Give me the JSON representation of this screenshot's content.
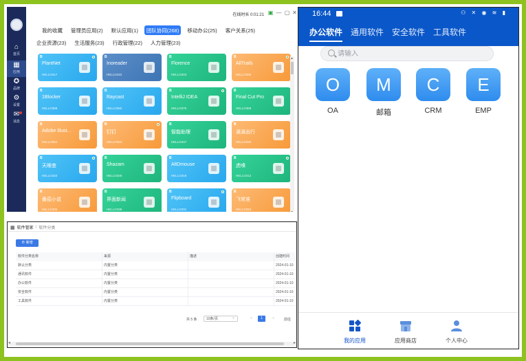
{
  "desktop": {
    "nav": [
      {
        "label": "首页",
        "icon": "home-icon"
      },
      {
        "label": "应用",
        "icon": "apps-icon"
      },
      {
        "label": "品牌",
        "icon": "brand-icon"
      },
      {
        "label": "设置",
        "icon": "settings-icon"
      },
      {
        "label": "消息",
        "icon": "message-icon"
      }
    ],
    "timer": "在线时长 0:01:21",
    "tabs_row1": [
      "我的收藏",
      "管理员应用(2)",
      "默认应用(1)",
      "团队协同(268)",
      "移动办公(25)",
      "客户关系(25)"
    ],
    "tabs_row2": [
      "企业资源(23)",
      "生活服务(23)",
      "行政管理(22)",
      "人力管理(23)"
    ],
    "cards": [
      {
        "name": "PlantNet",
        "sub": "HELLO417",
        "color": "blue",
        "badge": "B"
      },
      {
        "name": "Inoreader",
        "sub": "HELLO410",
        "color": "steel",
        "badge": "B"
      },
      {
        "name": "Florence",
        "sub": "HELLO403",
        "color": "green",
        "badge": "B"
      },
      {
        "name": "AllTrails",
        "sub": "HELLO396",
        "color": "orange",
        "badge": "B"
      },
      {
        "name": "1Blocker",
        "sub": "HELLO389",
        "color": "blue",
        "badge": "B"
      },
      {
        "name": "Raycast",
        "sub": "HELLO382",
        "color": "blue",
        "badge": "B"
      },
      {
        "name": "IntelliJ IDEA",
        "sub": "HELLO375",
        "color": "green",
        "badge": "B"
      },
      {
        "name": "Final Cut Pro",
        "sub": "HELLO368",
        "color": "green",
        "badge": "B"
      },
      {
        "name": "Adobe Illust...",
        "sub": "HELLO361",
        "color": "orange",
        "badge": "B"
      },
      {
        "name": "钉钉",
        "sub": "HELLO354",
        "color": "orange",
        "badge": "B"
      },
      {
        "name": "智能助理",
        "sub": "HELLO347",
        "color": "green",
        "badge": "B"
      },
      {
        "name": "滴滴出行",
        "sub": "HELLO340",
        "color": "orange",
        "badge": "B"
      },
      {
        "name": "天眼查",
        "sub": "HELLO333",
        "color": "blue",
        "badge": "B"
      },
      {
        "name": "Shazam",
        "sub": "HELLO326",
        "color": "green",
        "badge": "B"
      },
      {
        "name": "AltDmouse",
        "sub": "HELLO319",
        "color": "blue",
        "badge": "B"
      },
      {
        "name": "虎嗅",
        "sub": "HELLO312",
        "color": "green",
        "badge": "B"
      },
      {
        "name": "番茄小说",
        "sub": "HELLO305",
        "color": "orange",
        "badge": "B"
      },
      {
        "name": "界面新闻",
        "sub": "HELLO298",
        "color": "green",
        "badge": "B"
      },
      {
        "name": "Flipboard",
        "sub": "HELLO291",
        "color": "blue",
        "badge": "B"
      },
      {
        "name": "飞常准",
        "sub": "HELLO284",
        "color": "orange",
        "badge": "B"
      }
    ]
  },
  "table_panel": {
    "breadcrumb": [
      "软件管家",
      "/",
      "软件分类"
    ],
    "add_label": "新增",
    "columns": [
      "软件分类名称",
      "来源",
      "描述",
      "创建时间"
    ],
    "rows": [
      [
        "默认分类",
        "内置分类",
        "",
        "2024-01-10"
      ],
      [
        "通讯软件",
        "内置分类",
        "",
        "2024-01-10"
      ],
      [
        "办公软件",
        "内置分类",
        "",
        "2024-01-10"
      ],
      [
        "安全软件",
        "内置分类",
        "",
        "2024-01-10"
      ],
      [
        "工具软件",
        "内置分类",
        "",
        "2024-01-10"
      ]
    ],
    "pager": {
      "total": "共 5 条",
      "size": "10条/页",
      "prev": "<",
      "current": "1",
      "next": ">",
      "goto": "前往"
    }
  },
  "phone": {
    "time": "16:44",
    "status": "⚇ ✕ ◉ ≋ ▮",
    "tabs": [
      "办公软件",
      "通用软件",
      "安全软件",
      "工具软件"
    ],
    "search_placeholder": "请输入",
    "apps": [
      {
        "letter": "O",
        "label": "OA"
      },
      {
        "letter": "M",
        "label": "邮箱"
      },
      {
        "letter": "C",
        "label": "CRM"
      },
      {
        "letter": "E",
        "label": "EMP"
      }
    ],
    "bottom_nav": [
      {
        "label": "我的应用",
        "icon": "grid-apps-icon"
      },
      {
        "label": "应用商店",
        "icon": "store-icon"
      },
      {
        "label": "个人中心",
        "icon": "user-icon"
      }
    ]
  },
  "colors": {
    "frame_green": "#8ec21f",
    "nav_dark": "#1b2a5a",
    "accent_blue": "#2f7bf6",
    "phone_header": "#0a57c9"
  }
}
